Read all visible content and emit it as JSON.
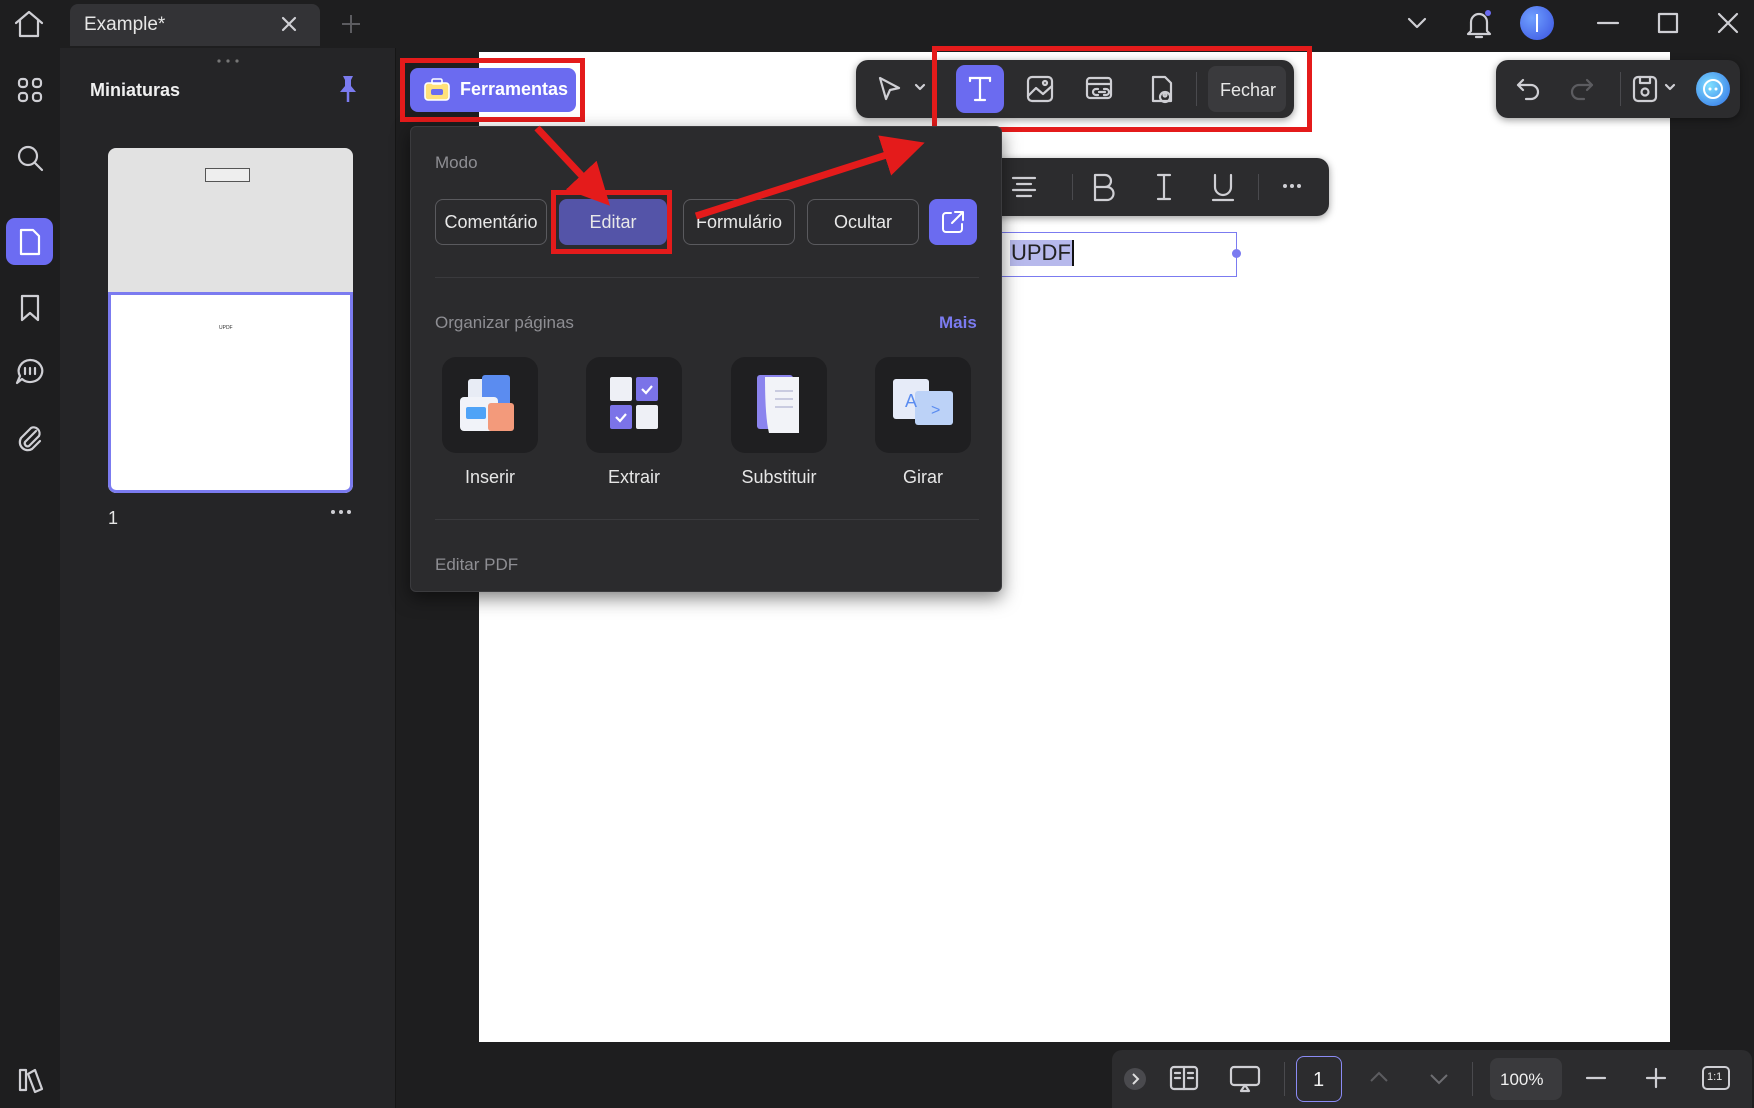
{
  "tab": {
    "title": "Example*"
  },
  "thumbnails": {
    "title": "Miniaturas",
    "page_number": "1",
    "mini_text": "UPDF"
  },
  "toolbar": {
    "tools_label": "Ferramentas",
    "close_label": "Fechar"
  },
  "document": {
    "text": "UPDF"
  },
  "popup": {
    "mode_label": "Modo",
    "modes": [
      "Comentário",
      "Editar",
      "Formulário",
      "Ocultar"
    ],
    "organize_label": "Organizar páginas",
    "more_label": "Mais",
    "tiles": [
      "Inserir",
      "Extrair",
      "Substituir",
      "Girar"
    ],
    "edit_pdf_label": "Editar PDF"
  },
  "bottom": {
    "page_input": "1",
    "zoom": "100%",
    "fit_label": "1:1"
  },
  "colors": {
    "accent": "#6b6bf0",
    "annotation_red": "#e41b1b",
    "background": "#1e1e1f",
    "panel": "#252527"
  }
}
